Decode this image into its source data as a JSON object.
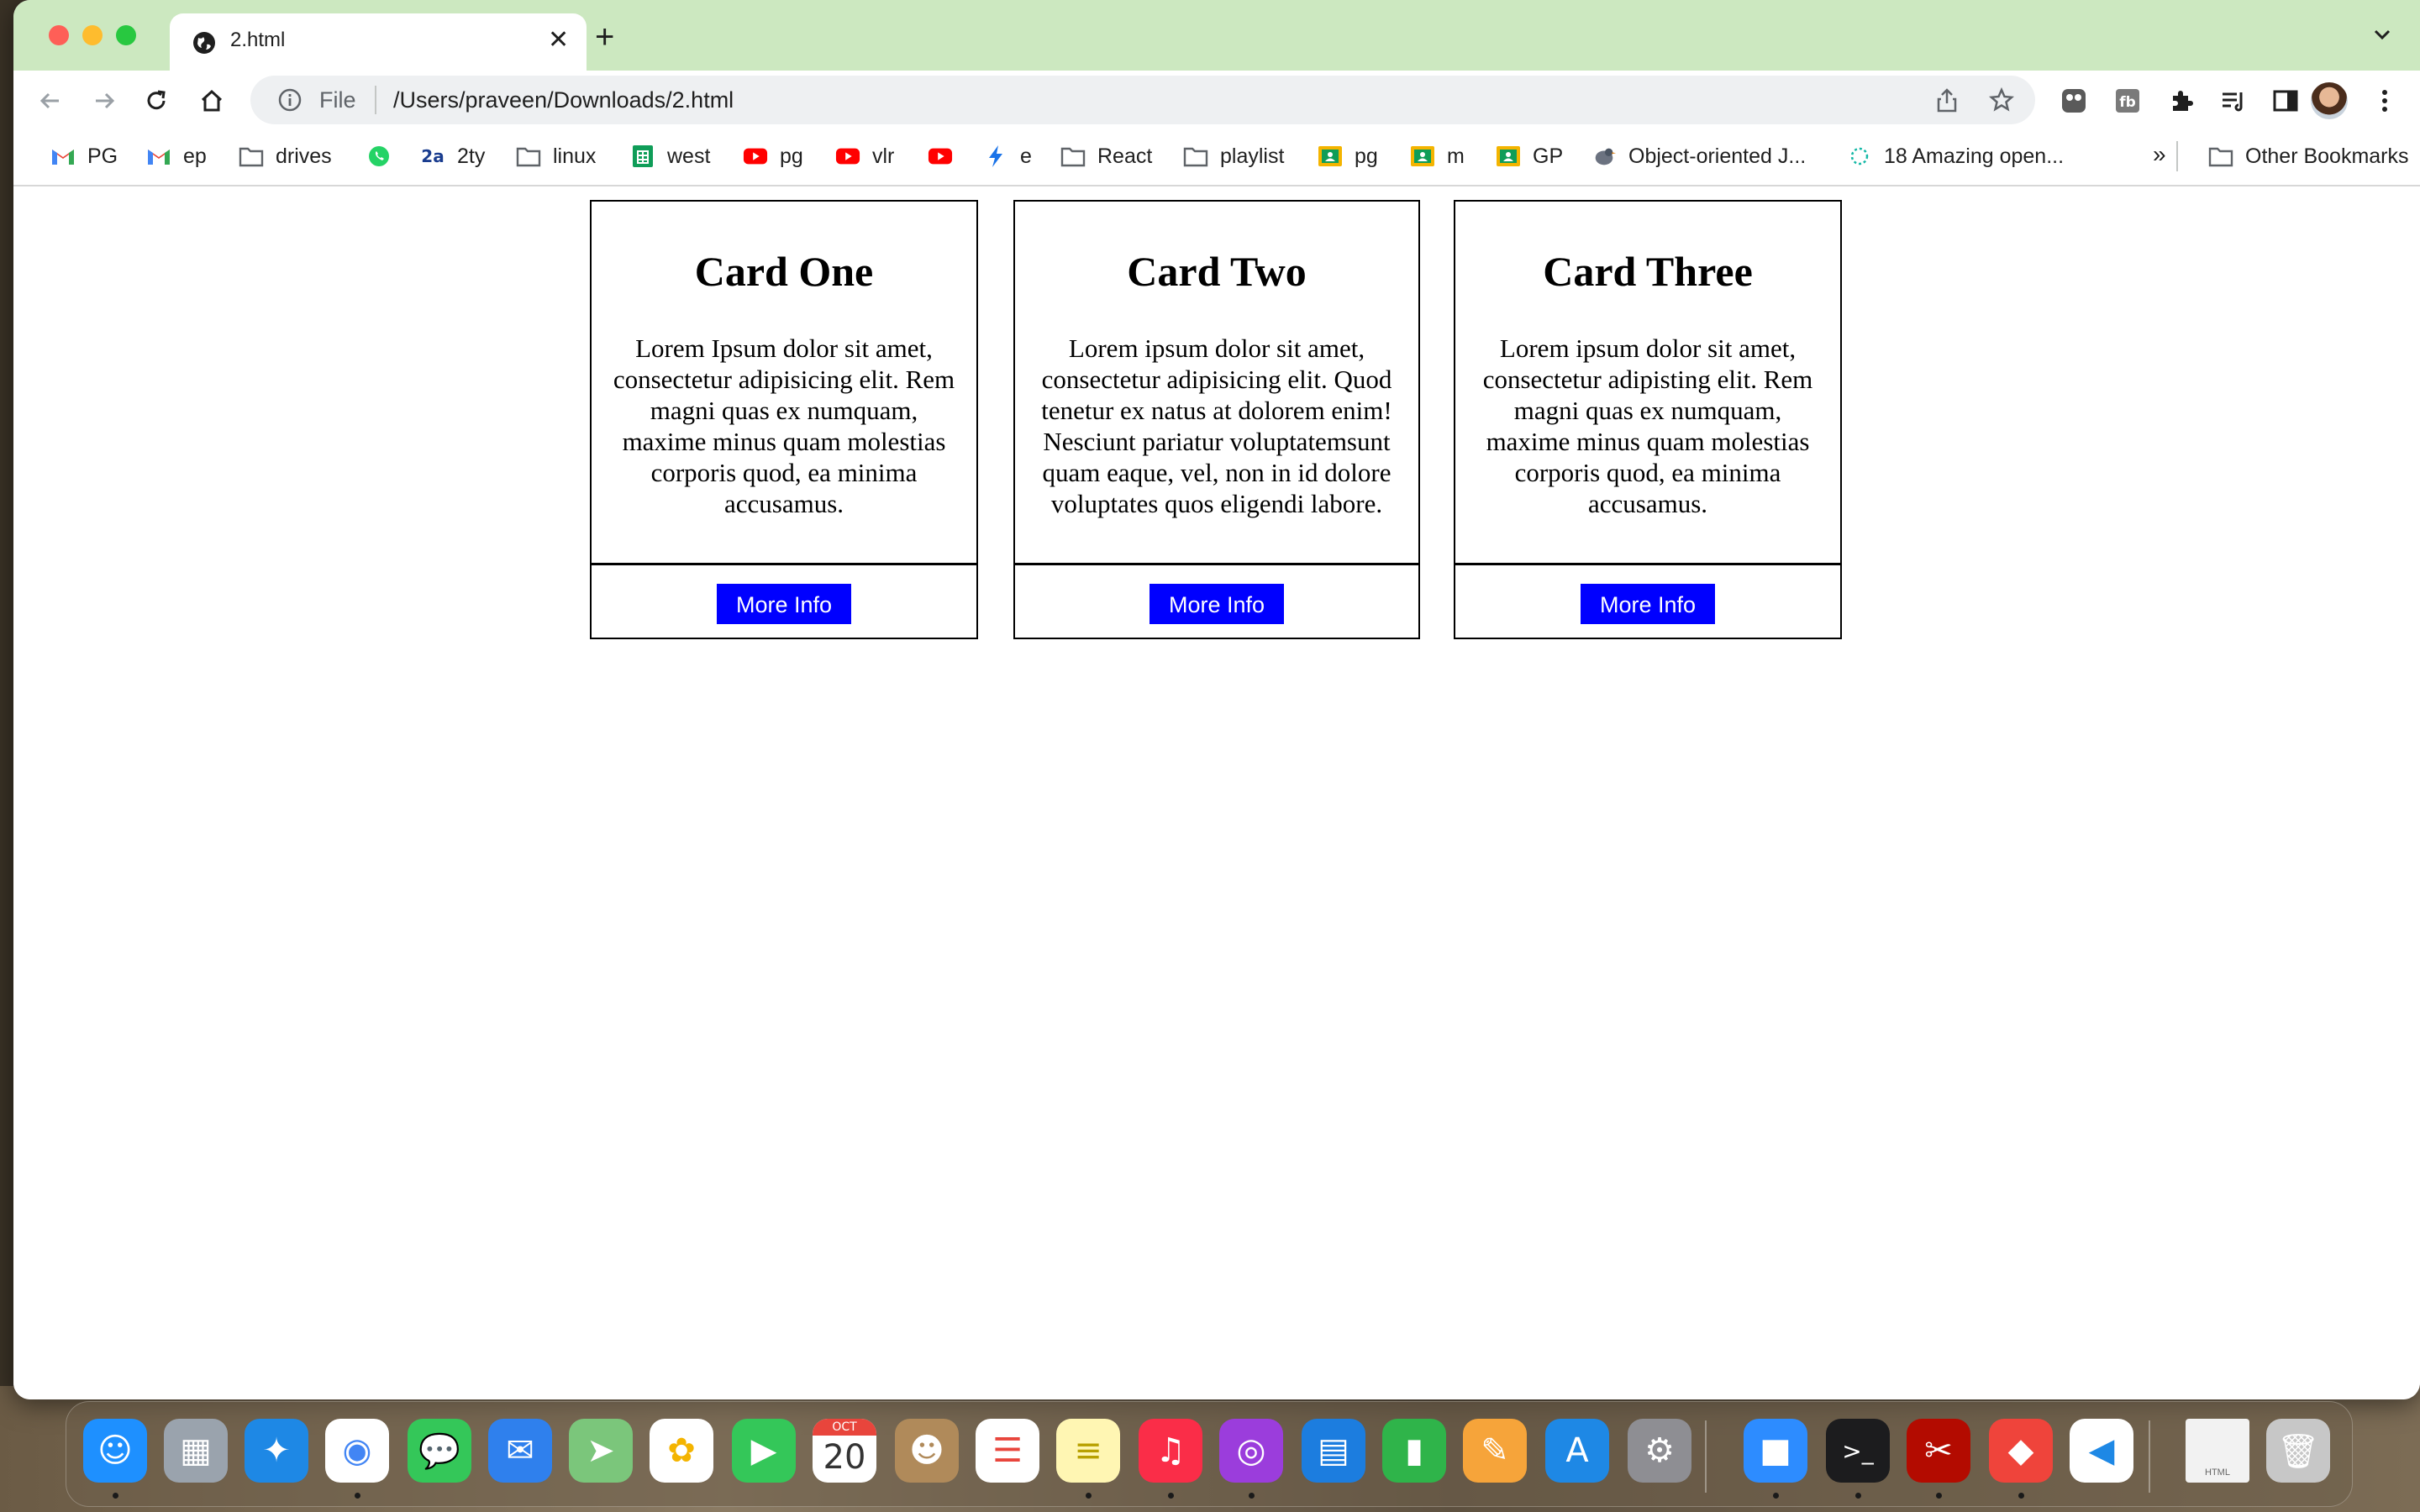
{
  "browser": {
    "tab_title": "2.html",
    "omnibox": {
      "scheme_label": "File",
      "url": "/Users/praveen/Downloads/2.html"
    }
  },
  "bookmarks": [
    {
      "label": "PG",
      "icon": "gmail-icon"
    },
    {
      "label": "ep",
      "icon": "gmail-icon"
    },
    {
      "label": "drives",
      "icon": "folder-icon"
    },
    {
      "label": "",
      "icon": "whatsapp-icon"
    },
    {
      "label": "2ty",
      "icon": "2a-icon",
      "badge": "2a"
    },
    {
      "label": "linux",
      "icon": "folder-icon"
    },
    {
      "label": "west",
      "icon": "sheets-icon"
    },
    {
      "label": "pg",
      "icon": "youtube-icon"
    },
    {
      "label": "vlr",
      "icon": "youtube-icon"
    },
    {
      "label": "",
      "icon": "youtube-icon"
    },
    {
      "label": "e",
      "icon": "lightning-icon"
    },
    {
      "label": "React",
      "icon": "folder-icon"
    },
    {
      "label": "playlist",
      "icon": "folder-icon"
    },
    {
      "label": "pg",
      "icon": "classroom-icon"
    },
    {
      "label": "m",
      "icon": "classroom-icon"
    },
    {
      "label": "GP",
      "icon": "classroom-icon"
    },
    {
      "label": "Object-oriented J...",
      "icon": "bird-icon"
    },
    {
      "label": "18 Amazing open...",
      "icon": "loading-icon"
    }
  ],
  "bookmarks_overflow": "»",
  "other_bookmarks": "Other Bookmarks",
  "cards": [
    {
      "title": "Card One",
      "text": "Lorem Ipsum dolor sit amet, consectetur adipisicing elit. Rem magni quas ex numquam, maxime minus quam molestias corporis quod, ea minima accusamus.",
      "button": "More Info"
    },
    {
      "title": "Card Two",
      "text": "Lorem ipsum dolor sit amet, consectetur adipisicing elit. Quod tenetur ex natus at dolorem enim! Nesciunt pariatur voluptatemsunt quam eaque, vel, non in id dolore voluptates quos eligendi labore.",
      "button": "More Info"
    },
    {
      "title": "Card Three",
      "text": "Lorem ipsum dolor sit amet, consectetur adipisting elit. Rem magni quas ex numquam, maxime minus quam molestias corporis quod, ea minima accusamus.",
      "button": "More Info"
    }
  ],
  "dock": {
    "calendar_month": "OCT",
    "calendar_day": "20",
    "html_file_label": "HTML",
    "apps": [
      "finder",
      "launchpad",
      "safari",
      "chrome",
      "messages",
      "mail",
      "maps",
      "photos",
      "facetime",
      "calendar",
      "contacts",
      "reminders",
      "notes",
      "music",
      "podcasts",
      "keynote",
      "numbers",
      "pages",
      "app-store",
      "system-preferences",
      "zoom",
      "terminal",
      "acrobat",
      "anydesk",
      "vscode",
      "html-file",
      "trash"
    ]
  }
}
